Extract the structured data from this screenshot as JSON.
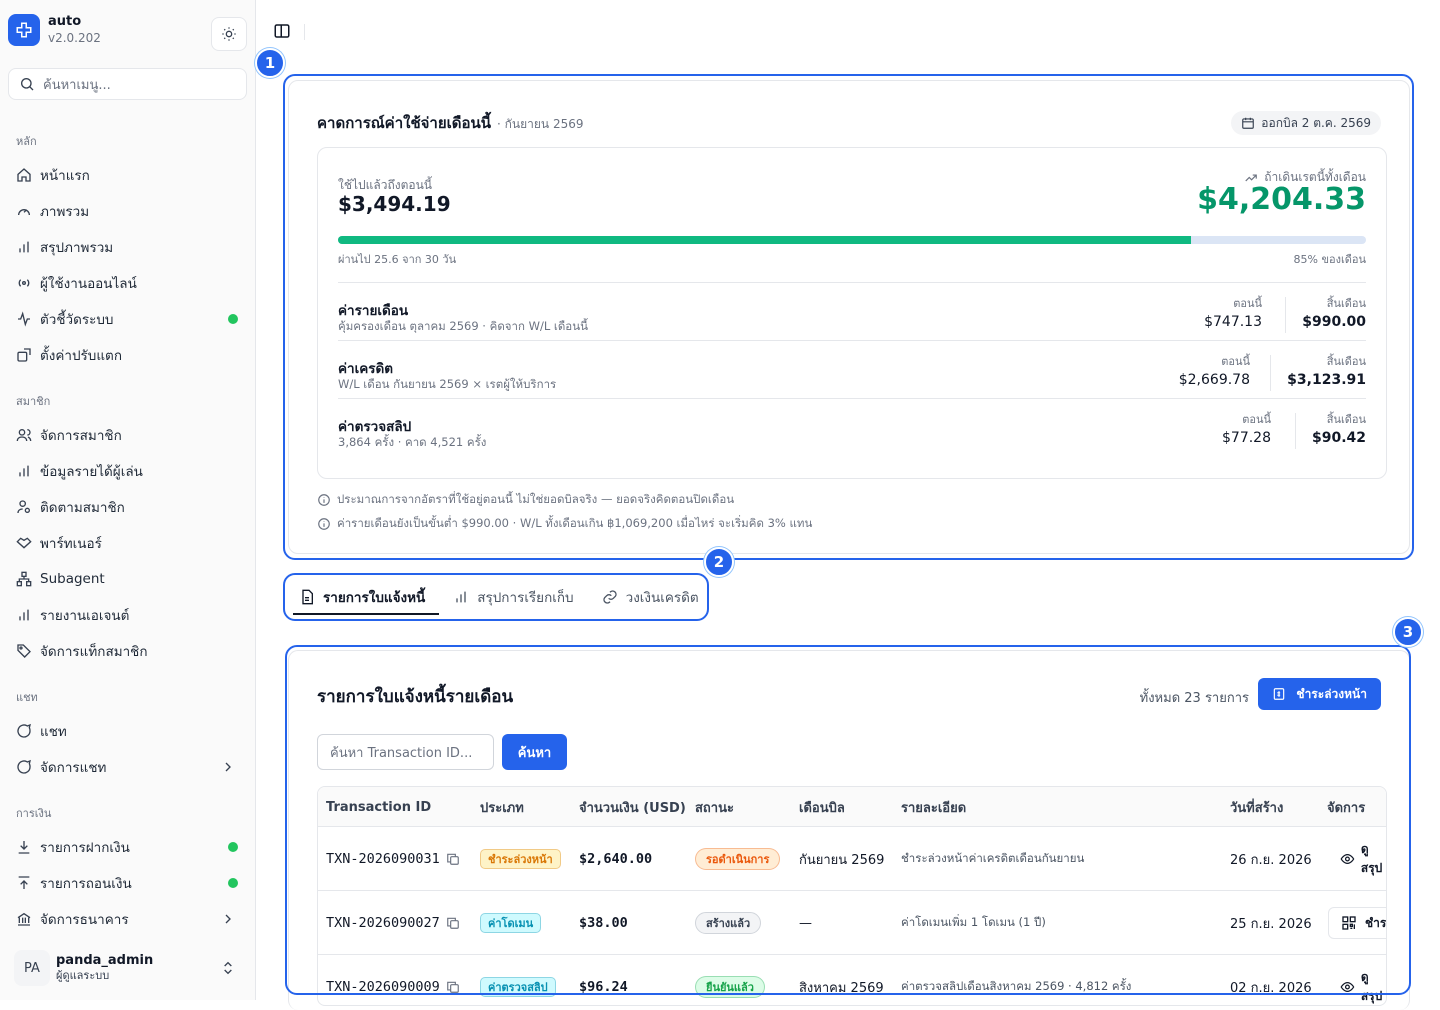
{
  "app": {
    "name": "auto",
    "version": "v2.0.202"
  },
  "sidebar": {
    "search_placeholder": "ค้นหาเมนู...",
    "groups": [
      {
        "label": "หลัก",
        "items": [
          {
            "label": "หน้าแรก"
          },
          {
            "label": "ภาพรวม"
          },
          {
            "label": "สรุปภาพรวม"
          },
          {
            "label": "ผู้ใช้งานออนไลน์"
          },
          {
            "label": "ตัวชี้วัดระบบ",
            "dot": true
          },
          {
            "label": "ตั้งค่าปรับแตก"
          }
        ]
      },
      {
        "label": "สมาชิก",
        "items": [
          {
            "label": "จัดการสมาชิก"
          },
          {
            "label": "ข้อมูลรายได้ผู้เล่น"
          },
          {
            "label": "ติดตามสมาชิก"
          },
          {
            "label": "พาร์ทเนอร์"
          },
          {
            "label": "Subagent"
          },
          {
            "label": "รายงานเอเจนต์"
          },
          {
            "label": "จัดการแท็กสมาชิก"
          }
        ]
      },
      {
        "label": "แชท",
        "items": [
          {
            "label": "แชท"
          },
          {
            "label": "จัดการแชท",
            "chevron": true
          }
        ]
      },
      {
        "label": "การเงิน",
        "items": [
          {
            "label": "รายการฝากเงิน",
            "dot": true
          },
          {
            "label": "รายการถอนเงิน",
            "dot": true
          },
          {
            "label": "จัดการธนาคาร",
            "chevron": true
          }
        ]
      }
    ],
    "user": {
      "initials": "PA",
      "name": "panda_admin",
      "role": "ผู้ดูแลระบบ"
    }
  },
  "annotations": [
    "1",
    "2",
    "3"
  ],
  "forecast": {
    "title": "คาดการณ์ค่าใช้จ่ายเดือนนี้",
    "period": "· กันยายน 2569",
    "bill_pill": "ออกบิล 2 ต.ค. 2569",
    "used_label": "ใช้ไปแล้วถึงตอนนี้",
    "used_value": "$3,494.19",
    "projected_label": "ถ้าเดินเรตนี้ทั้งเดือน",
    "projected_value": "$4,204.33",
    "progress": 0.83,
    "elapsed_text": "ผ่านไป 25.6 จาก 30 วัน",
    "percent_text": "85% ของเดือน",
    "now_caption": "ตอนนี้",
    "end_caption": "สิ้นเดือน",
    "lines": [
      {
        "name": "ค่ารายเดือน",
        "desc": "คุ้มครองเดือน ตุลาคม 2569 · คิดจาก W/L เดือนนี้",
        "now": "$747.13",
        "end": "$990.00"
      },
      {
        "name": "ค่าเครดิต",
        "desc": "W/L เดือน กันยายน 2569 × เรตผู้ให้บริการ",
        "now": "$2,669.78",
        "end": "$3,123.91"
      },
      {
        "name": "ค่าตรวจสลิป",
        "desc": "3,864 ครั้ง · คาด 4,521 ครั้ง",
        "now": "$77.28",
        "end": "$90.42"
      }
    ],
    "notes": [
      "ประมาณการจากอัตราที่ใช้อยู่ตอนนี้ ไม่ใช่ยอดบิลจริง — ยอดจริงคิดตอนปิดเดือน",
      "ค่ารายเดือนยังเป็นขั้นต่ำ $990.00 · W/L ทั้งเดือนเกิน ฿1,069,200 เมื่อไหร่ จะเริ่มคิด 3% แทน"
    ]
  },
  "tabs": [
    {
      "label": "รายการใบแจ้งหนี้"
    },
    {
      "label": "สรุปการเรียกเก็บ"
    },
    {
      "label": "วงเงินเครดิต"
    }
  ],
  "invoices": {
    "title": "รายการใบแจ้งหนี้รายเดือน",
    "count": "ทั้งหมด 23 รายการ",
    "prepay_label": "ชำระล่วงหน้า",
    "search_placeholder": "ค้นหา Transaction ID...",
    "search_button": "ค้นหา",
    "columns": [
      "Transaction ID",
      "ประเภท",
      "จำนวนเงิน (USD)",
      "สถานะ",
      "เดือนบิล",
      "รายละเอียด",
      "วันที่สร้าง",
      "จัดการ"
    ],
    "rows": [
      {
        "id": "TXN-2026090031",
        "type": "ชำระล่วงหน้า",
        "type_color": "#d97706",
        "type_bg": "#fef3c7",
        "amount": "$2,640.00",
        "status": "รอดำเนินการ",
        "status_color": "#ea580c",
        "status_bg": "#ffedd5",
        "month": "กันยายน 2569",
        "desc": "ชำระล่วงหน้าค่าเครดิตเดือนกันยายน",
        "created": "26 ก.ย. 2026",
        "action": "ดูสรุป",
        "action_type": "view"
      },
      {
        "id": "TXN-2026090027",
        "type": "ค่าโดเมน",
        "type_color": "#0891b2",
        "type_bg": "#cffafe",
        "amount": "$38.00",
        "status": "สร้างแล้ว",
        "status_color": "#374151",
        "status_bg": "#f3f4f6",
        "month": "—",
        "desc": "ค่าโดเมนเพิ่ม 1 โดเมน (1 ปี)",
        "created": "25 ก.ย. 2026",
        "action": "ชำระ",
        "action_type": "qr"
      },
      {
        "id": "TXN-2026090009",
        "type": "ค่าตรวจสลิป",
        "type_color": "#0891b2",
        "type_bg": "#cffafe",
        "amount": "$96.24",
        "status": "ยืนยันแล้ว",
        "status_color": "#16a34a",
        "status_bg": "#dcfce7",
        "month": "สิงหาคม 2569",
        "desc": "ค่าตรวจสลิปเดือนสิงหาคม 2569 · 4,812 ครั้ง",
        "created": "02 ก.ย. 2026",
        "action": "ดูสรุป",
        "action_type": "view"
      }
    ]
  }
}
